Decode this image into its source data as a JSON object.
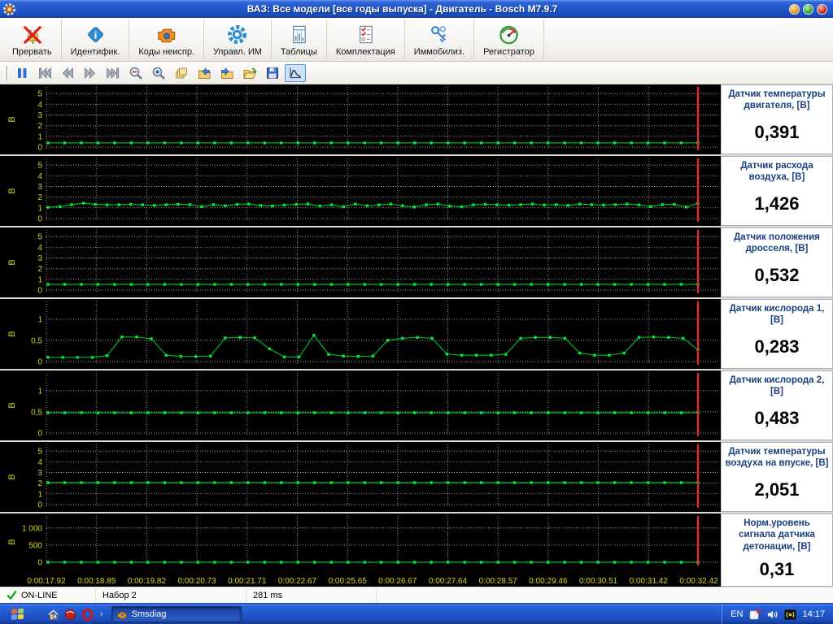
{
  "window": {
    "title": "ВАЗ: Все модели [все годы выпуска] - Двигатель - Bosch M7.9.7"
  },
  "toolbar": {
    "buttons": [
      {
        "label": "Прервать",
        "icon": "abort-icon"
      },
      {
        "label": "Идентифик.",
        "icon": "identify-icon"
      },
      {
        "label": "Коды неиспр.",
        "icon": "trouble-codes-icon"
      },
      {
        "label": "Управл. ИМ",
        "icon": "actuator-control-icon"
      },
      {
        "label": "Таблицы",
        "icon": "tables-icon"
      },
      {
        "label": "Комплектация",
        "icon": "equipment-icon"
      },
      {
        "label": "Иммобилиз.",
        "icon": "immobilizer-icon"
      },
      {
        "label": "Регистратор",
        "icon": "recorder-icon"
      }
    ]
  },
  "playback_toolbar": {
    "buttons": [
      {
        "icon": "pause-icon",
        "active": false
      },
      {
        "icon": "skip-start-icon",
        "active": false
      },
      {
        "icon": "rewind-icon",
        "active": false
      },
      {
        "icon": "fast-forward-icon",
        "active": false
      },
      {
        "icon": "skip-end-icon",
        "active": false
      },
      {
        "icon": "zoom-out-icon",
        "active": false
      },
      {
        "icon": "zoom-in-icon",
        "active": false
      },
      {
        "icon": "copy-icon",
        "active": false
      },
      {
        "icon": "folder-in-icon",
        "active": false
      },
      {
        "icon": "folder-out-icon",
        "active": false
      },
      {
        "icon": "folder-open-icon",
        "active": false
      },
      {
        "icon": "save-icon",
        "active": false
      },
      {
        "icon": "chart-icon",
        "active": true
      }
    ]
  },
  "colors": {
    "plot_line": "#00b82e",
    "plot_marker": "#00e83c",
    "tick_label": "#d8d41c",
    "grid": "#8c8c8c",
    "cursor": "#ff2020",
    "info_label": "#17407e",
    "info_value": "#000000"
  },
  "chart_x_labels": [
    "0:00:17.92",
    "0:00:18.85",
    "0:00:19.82",
    "0:00:20.73",
    "0:00:21.71",
    "0:00:22.67",
    "0:00:25.65",
    "0:00:26.67",
    "0:00:27.64",
    "0:00:28.57",
    "0:00:29.46",
    "0:00:30.51",
    "0:00:31.42",
    "0:00:32.42"
  ],
  "chart_data": [
    {
      "type": "line",
      "label": "Датчик температуры двигателя, [В]",
      "value": "0,391",
      "axis_unit": "В",
      "ytick_values": [
        0,
        1,
        2,
        3,
        4,
        5
      ],
      "ytick_labels": [
        "0",
        "1",
        "2",
        "3",
        "4",
        "5"
      ],
      "ytop": 5.62,
      "values": [
        0.39,
        0.39,
        0.39,
        0.39,
        0.39,
        0.39,
        0.39,
        0.39,
        0.39,
        0.39,
        0.39,
        0.39,
        0.39,
        0.39,
        0.39,
        0.39,
        0.39,
        0.39,
        0.39,
        0.39,
        0.39,
        0.39,
        0.39,
        0.39,
        0.39,
        0.39,
        0.39,
        0.39,
        0.39,
        0.39,
        0.39,
        0.39,
        0.39,
        0.39,
        0.39,
        0.39,
        0.39,
        0.39,
        0.39,
        0.391
      ]
    },
    {
      "type": "line",
      "label": "Датчик расхода воздуха, [В]",
      "value": "1,426",
      "axis_unit": "В",
      "ytick_values": [
        0,
        1,
        2,
        3,
        4,
        5
      ],
      "ytick_labels": [
        "0",
        "1",
        "2",
        "3",
        "4",
        "5"
      ],
      "ytop": 5.62,
      "values": [
        1.05,
        1.12,
        1.3,
        1.44,
        1.32,
        1.28,
        1.3,
        1.33,
        1.28,
        1.22,
        1.3,
        1.34,
        1.3,
        1.12,
        1.3,
        1.2,
        1.33,
        1.36,
        1.22,
        1.18,
        1.27,
        1.32,
        1.36,
        1.18,
        1.28,
        1.1,
        1.36,
        1.2,
        1.28,
        1.36,
        1.2,
        1.08,
        1.28,
        1.36,
        1.18,
        1.1,
        1.28,
        1.33,
        1.28,
        1.25,
        1.3,
        1.36,
        1.27,
        1.3,
        1.22,
        1.36,
        1.3,
        1.27,
        1.3,
        1.36,
        1.28,
        1.12,
        1.3,
        1.33,
        1.08,
        1.426
      ]
    },
    {
      "type": "line",
      "label": "Датчик положения дросселя, [В]",
      "value": "0,532",
      "axis_unit": "В",
      "ytick_values": [
        0,
        1,
        2,
        3,
        4,
        5
      ],
      "ytick_labels": [
        "0",
        "1",
        "2",
        "3",
        "4",
        "5"
      ],
      "ytop": 5.62,
      "values": [
        0.53,
        0.53,
        0.53,
        0.53,
        0.53,
        0.53,
        0.53,
        0.53,
        0.53,
        0.53,
        0.53,
        0.53,
        0.53,
        0.53,
        0.53,
        0.53,
        0.53,
        0.53,
        0.53,
        0.53,
        0.53,
        0.53,
        0.53,
        0.53,
        0.53,
        0.53,
        0.53,
        0.53,
        0.53,
        0.53,
        0.53,
        0.53,
        0.53,
        0.53,
        0.53,
        0.53,
        0.53,
        0.53,
        0.53,
        0.532
      ]
    },
    {
      "type": "line",
      "label": "Датчик кислорода 1, [В]",
      "value": "0,283",
      "axis_unit": "В",
      "ytick_values": [
        0,
        0.5,
        1
      ],
      "ytick_labels": [
        "0",
        "0,5",
        "1"
      ],
      "ytop": 1.42,
      "values": [
        0.1,
        0.1,
        0.1,
        0.1,
        0.14,
        0.58,
        0.58,
        0.54,
        0.15,
        0.12,
        0.12,
        0.13,
        0.56,
        0.57,
        0.56,
        0.3,
        0.11,
        0.11,
        0.62,
        0.17,
        0.13,
        0.12,
        0.13,
        0.5,
        0.55,
        0.57,
        0.55,
        0.18,
        0.15,
        0.15,
        0.15,
        0.17,
        0.55,
        0.57,
        0.57,
        0.55,
        0.2,
        0.15,
        0.15,
        0.2,
        0.57,
        0.58,
        0.57,
        0.55,
        0.283
      ]
    },
    {
      "type": "line",
      "label": "Датчик кислорода 2, [В]",
      "value": "0,483",
      "axis_unit": "В",
      "ytick_values": [
        0,
        0.5,
        1
      ],
      "ytick_labels": [
        "0",
        "0,5",
        "1"
      ],
      "ytop": 1.42,
      "values": [
        0.48,
        0.48,
        0.48,
        0.48,
        0.48,
        0.48,
        0.48,
        0.48,
        0.48,
        0.48,
        0.48,
        0.48,
        0.48,
        0.48,
        0.48,
        0.48,
        0.48,
        0.48,
        0.48,
        0.48,
        0.48,
        0.48,
        0.48,
        0.48,
        0.48,
        0.48,
        0.48,
        0.48,
        0.48,
        0.48,
        0.48,
        0.48,
        0.48,
        0.48,
        0.48,
        0.48,
        0.48,
        0.48,
        0.48,
        0.483
      ]
    },
    {
      "type": "line",
      "label": "Датчик температуры воздуха на впуске, [В]",
      "value": "2,051",
      "axis_unit": "В",
      "ytick_values": [
        0,
        1,
        2,
        3,
        4,
        5
      ],
      "ytick_labels": [
        "0",
        "1",
        "2",
        "3",
        "4",
        "5"
      ],
      "ytop": 5.62,
      "values": [
        2.05,
        2.05,
        2.05,
        2.05,
        2.05,
        2.05,
        2.05,
        2.05,
        2.05,
        2.05,
        2.05,
        2.05,
        2.05,
        2.05,
        2.05,
        2.05,
        2.05,
        2.05,
        2.05,
        2.05,
        2.05,
        2.05,
        2.05,
        2.05,
        2.05,
        2.05,
        2.05,
        2.05,
        2.05,
        2.05,
        2.05,
        2.05,
        2.05,
        2.05,
        2.05,
        2.05,
        2.05,
        2.05,
        2.05,
        2.051
      ]
    },
    {
      "type": "line",
      "label": "Норм.уровень сигнала датчика детонации, [В]",
      "value": "0,31",
      "axis_unit": "В",
      "ytick_values": [
        0,
        500,
        1000
      ],
      "ytick_labels": [
        "0",
        "500",
        "1 000"
      ],
      "ytop": 1350,
      "values": [
        0.31,
        0.31,
        0.31,
        0.31,
        0.31,
        0.31,
        0.31,
        0.31,
        0.31,
        0.31,
        0.31,
        0.31,
        0.31,
        0.31,
        0.31,
        0.31,
        0.31,
        0.31,
        0.31,
        0.31,
        0.31,
        0.31,
        0.31,
        0.31,
        0.31,
        0.31,
        0.31,
        0.31,
        0.31,
        0.31,
        0.31,
        0.31,
        0.31,
        0.31,
        0.31,
        0.31,
        0.31,
        0.31,
        0.31,
        0.31
      ]
    }
  ],
  "status_bar": {
    "online_label": "ON-LINE",
    "dataset_label": "Набор 2",
    "latency_label": "281 ms"
  },
  "taskbar": {
    "task_label": "Smsdiag",
    "language_label": "EN",
    "clock_label": "14:17"
  }
}
